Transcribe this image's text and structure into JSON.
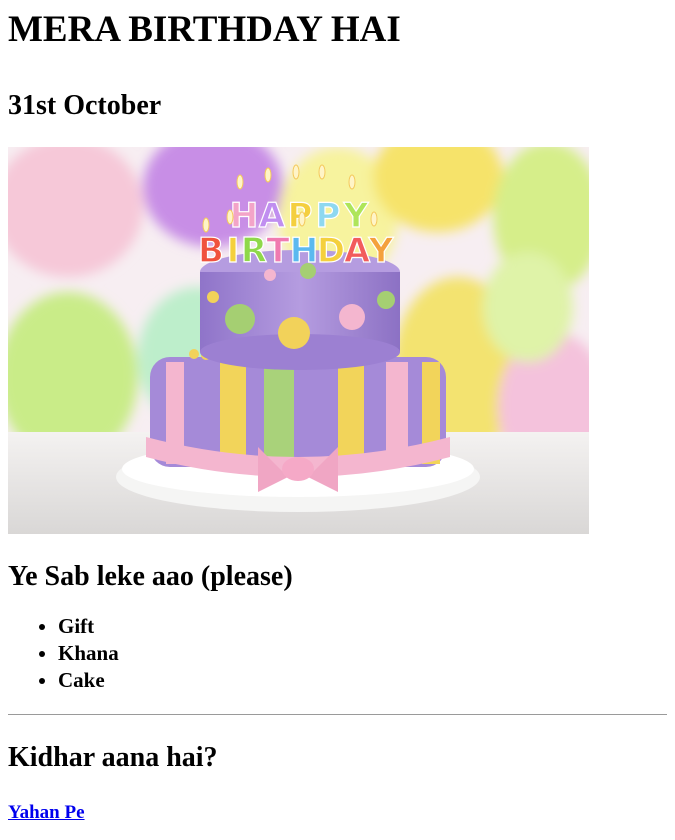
{
  "page": {
    "heading": "MERA BIRTHDAY HAI",
    "date": "31st October"
  },
  "image": {
    "subject": "birthday cake",
    "candle_text": "HAPPY BIRTHDAY"
  },
  "bring_section": {
    "title": "Ye Sab leke aao (please)",
    "items": [
      "Gift",
      "Khana",
      "Cake"
    ]
  },
  "where_section": {
    "title": "Kidhar aana hai?",
    "link_text": "Yahan Pe"
  },
  "colors": {
    "link": "#0000ee",
    "cake_purple": "#a889d6",
    "ribbon_pink": "#f4b6cf",
    "stripe_yellow": "#f2d45a",
    "stripe_green": "#a9d27a"
  }
}
